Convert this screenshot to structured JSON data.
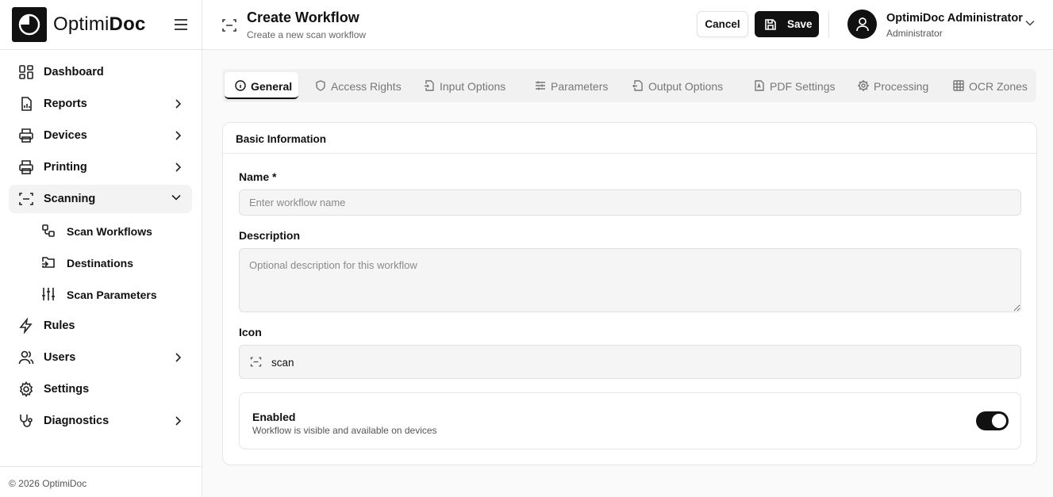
{
  "brand": {
    "name_light": "Optimi",
    "name_bold": "Doc"
  },
  "sidebar": {
    "items": [
      {
        "label": "Dashboard",
        "icon": "dashboard-icon",
        "has_chevron": false
      },
      {
        "label": "Reports",
        "icon": "report-icon",
        "has_chevron": true
      },
      {
        "label": "Devices",
        "icon": "printer-icon",
        "has_chevron": true
      },
      {
        "label": "Printing",
        "icon": "printer-icon",
        "has_chevron": true
      },
      {
        "label": "Scanning",
        "icon": "scan-icon",
        "has_chevron": true,
        "expanded": true,
        "active": true
      },
      {
        "label": "Rules",
        "icon": "lightning-icon",
        "has_chevron": false
      },
      {
        "label": "Users",
        "icon": "users-icon",
        "has_chevron": true
      },
      {
        "label": "Settings",
        "icon": "gear-icon",
        "has_chevron": false
      },
      {
        "label": "Diagnostics",
        "icon": "stethoscope-icon",
        "has_chevron": true
      }
    ],
    "sub_items": [
      {
        "label": "Scan Workflows",
        "icon": "workflow-icon"
      },
      {
        "label": "Destinations",
        "icon": "folder-input-icon"
      },
      {
        "label": "Scan Parameters",
        "icon": "sliders-icon"
      }
    ],
    "footer": "© 2026 OptimiDoc"
  },
  "header": {
    "title": "Create Workflow",
    "subtitle": "Create a new scan workflow",
    "cancel_label": "Cancel",
    "save_label": "Save"
  },
  "user": {
    "name": "OptimiDoc Administrator",
    "role": "Administrator"
  },
  "tabs": [
    {
      "label": "General",
      "icon": "info-icon",
      "active": true
    },
    {
      "label": "Access Rights",
      "icon": "shield-icon"
    },
    {
      "label": "Input Options",
      "icon": "file-input-icon"
    },
    {
      "label": "Parameters",
      "icon": "sliders-horizontal-icon"
    },
    {
      "label": "Output Options",
      "icon": "file-output-icon"
    },
    {
      "label": "PDF Settings",
      "icon": "file-pdf-icon"
    },
    {
      "label": "Processing",
      "icon": "cog-icon"
    },
    {
      "label": "OCR Zones",
      "icon": "grid-icon"
    }
  ],
  "form": {
    "section_title": "Basic Information",
    "name_label": "Name *",
    "name_value": "",
    "name_placeholder": "Enter workflow name",
    "description_label": "Description",
    "description_value": "",
    "description_placeholder": "Optional description for this workflow",
    "icon_label": "Icon",
    "icon_value": "scan",
    "enabled_title": "Enabled",
    "enabled_description": "Workflow is visible and available on devices",
    "enabled": true
  },
  "colors": {
    "accent": "#111111",
    "muted_bg": "#f5f5f5",
    "border": "#e6e6e6"
  }
}
